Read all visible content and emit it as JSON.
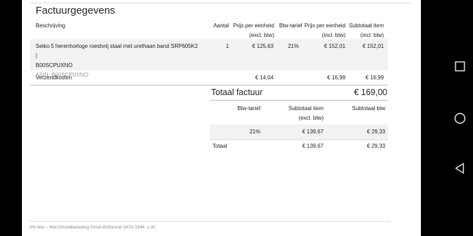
{
  "section_title": "Factuurgegevens",
  "table": {
    "headers": {
      "description": "Beschrijving",
      "quantity": "Aantal",
      "unit_price_excl": "Prijs per eenheid",
      "unit_price_excl_sub": "(excl. btw)",
      "vat_rate": "Btw-tarief",
      "unit_price_incl": "Prijs per eenheid",
      "unit_price_incl_sub": "(incl. btw)",
      "subtotal": "Subtotaal item",
      "subtotal_sub": "(incl. btw)"
    },
    "rows": [
      {
        "description_line1": "Seiko 5 herenhorloge roestvrij staal met urethaan band SRP605K2 |",
        "description_line2": "B00SCPUXNO",
        "asin": "ASIN: B00SCPUXNO",
        "quantity": "1",
        "unit_price_excl": "€ 125,63",
        "vat_rate": "21%",
        "unit_price_incl": "€ 152,01",
        "subtotal": "€ 152,01"
      }
    ],
    "shipping": {
      "label": "Verzendkosten",
      "unit_price_excl": "€ 14,04",
      "unit_price_incl": "€ 16,99",
      "subtotal": "€ 16,99"
    }
  },
  "total": {
    "label": "Totaal factuur",
    "value": "€ 169,00"
  },
  "vat_summary": {
    "headers": {
      "vat_rate": "Btw-tarief",
      "subtotal_excl": "Subtotaal item",
      "subtotal_excl_sub": "(excl. btw)",
      "subtotal_vat": "Subtotaal btw"
    },
    "row": {
      "vat_rate": "21%",
      "subtotal_excl": "€ 139,67",
      "subtotal_vat": "€ 29,33"
    },
    "total": {
      "label": "Totaal",
      "subtotal_excl": "€ 139,67",
      "subtotal_vat": "€ 29,33"
    }
  },
  "footer_note": "0% btw – Wet Omzetbelasting Groot-Brittannië VATA 1994, s.30",
  "android_nav": {
    "recents_icon": "square-recents-icon",
    "home_icon": "circle-home-icon",
    "back_icon": "triangle-back-icon"
  }
}
